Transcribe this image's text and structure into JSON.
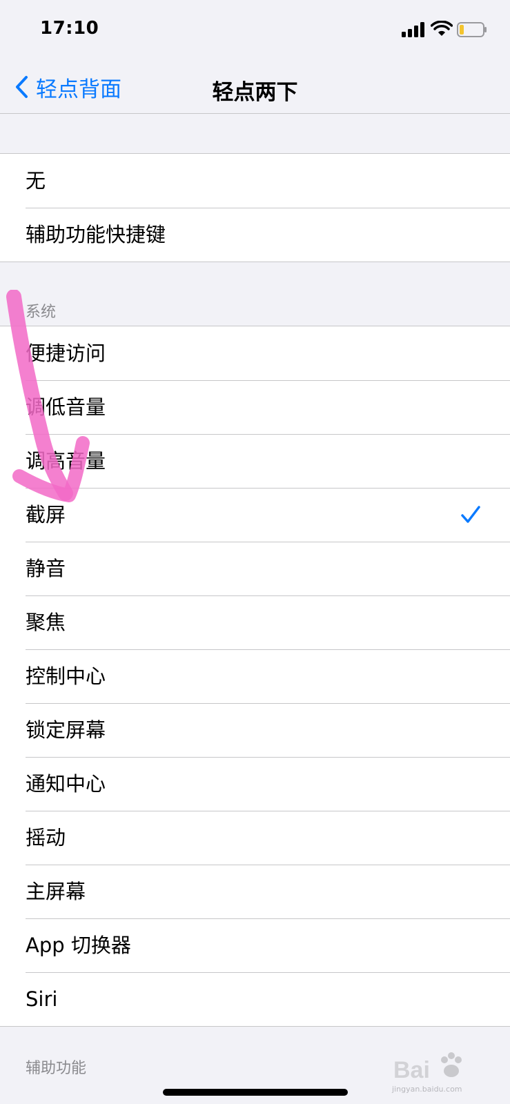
{
  "status_bar": {
    "time": "17:10"
  },
  "nav": {
    "back_label": "轻点背面",
    "title": "轻点两下"
  },
  "group1": {
    "items": [
      "无",
      "辅助功能快捷键"
    ]
  },
  "system_section": {
    "header": "系统",
    "items": [
      "便捷访问",
      "调低音量",
      "调高音量",
      "截屏",
      "静音",
      "聚焦",
      "控制中心",
      "锁定屏幕",
      "通知中心",
      "摇动",
      "主屏幕",
      "App 切换器",
      "Siri"
    ],
    "selected": "截屏"
  },
  "accessibility_section": {
    "header": "辅助功能"
  },
  "watermark": {
    "text": "jingyan.baidu.com"
  },
  "colors": {
    "accent": "#0a7aff",
    "annotation": "#f26ac7"
  }
}
